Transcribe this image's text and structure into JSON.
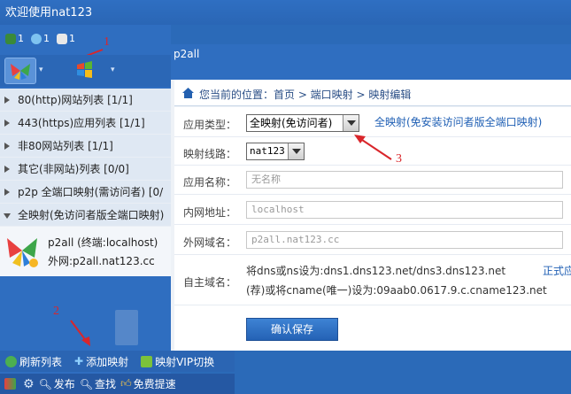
{
  "window": {
    "title": "欢迎使用nat123"
  },
  "status": {
    "a": "1",
    "b": "1",
    "c": "1"
  },
  "menu": {
    "items": [
      {
        "label": "80(http)网站列表  [1/1]"
      },
      {
        "label": "443(https)应用列表  [1/1]"
      },
      {
        "label": "非80网站列表  [1/1]"
      },
      {
        "label": "其它(非网站)列表  [0/0]"
      },
      {
        "label": "p2p 全端口映射(需访问者)  [0/"
      },
      {
        "label": "全映射(免访问者版全端口映射)"
      }
    ],
    "entry": {
      "line1": "p2all  (终端:localhost)",
      "line2": "外网:p2all.nat123.cc"
    }
  },
  "bottombar": {
    "refresh": "刷新列表",
    "add": "添加映射",
    "vip": "映射VIP切换",
    "publish": "发布",
    "search": "查找",
    "speed": "免费提速"
  },
  "dialog": {
    "title": "p2all",
    "breadcrumb": "您当前的位置：首页 > 端口映射 > 映射编辑",
    "fields": {
      "type_label": "应用类型：",
      "type_value": "全映射(免访问者)",
      "type_link": "全映射(免安装访问者版全端口映射)",
      "line_label": "映射线路：",
      "line_value": "nat123",
      "name_label": "应用名称：",
      "name_placeholder": "无名称",
      "lan_label": "内网地址：",
      "lan_value": "localhost",
      "wan_label": "外网域名：",
      "wan_value": "p2all.nat123.cc",
      "domain_label": "自主域名：",
      "dns1": "将dns或ns设为:dns1.dns123.net/dns3.dns123.net",
      "dns_link": "正式应",
      "dns2": "(荐)或将cname(唯一)设为:09aab0.0617.9.c.cname123.net"
    },
    "save_label": "确认保存"
  },
  "annotations": {
    "n1": "1",
    "n2": "2",
    "n3": "3"
  }
}
